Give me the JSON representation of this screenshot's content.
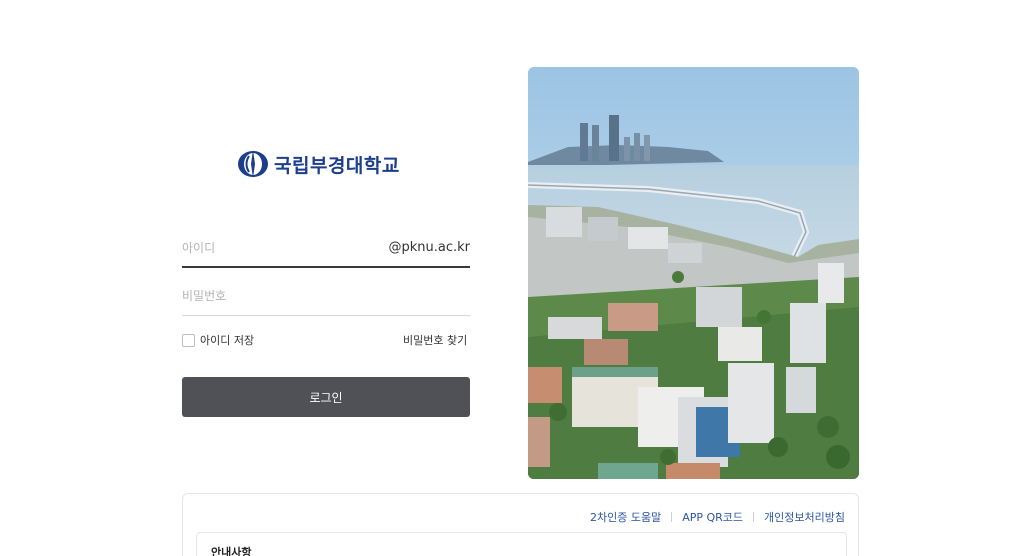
{
  "logo": {
    "name": "국립부경대학교"
  },
  "login": {
    "id_placeholder": "아이디",
    "domain_suffix": "@pknu.ac.kr",
    "pw_placeholder": "비밀번호",
    "remember_label": "아이디 저장",
    "find_password": "비밀번호 찾기",
    "submit_label": "로그인"
  },
  "footer": {
    "links": [
      "2차인증 도움말",
      "APP QR코드",
      "개인정보처리방침"
    ],
    "notice_title": "안내사항"
  },
  "colors": {
    "brand": "#1d3e8a",
    "button": "#505156",
    "link": "#2a55a5"
  }
}
